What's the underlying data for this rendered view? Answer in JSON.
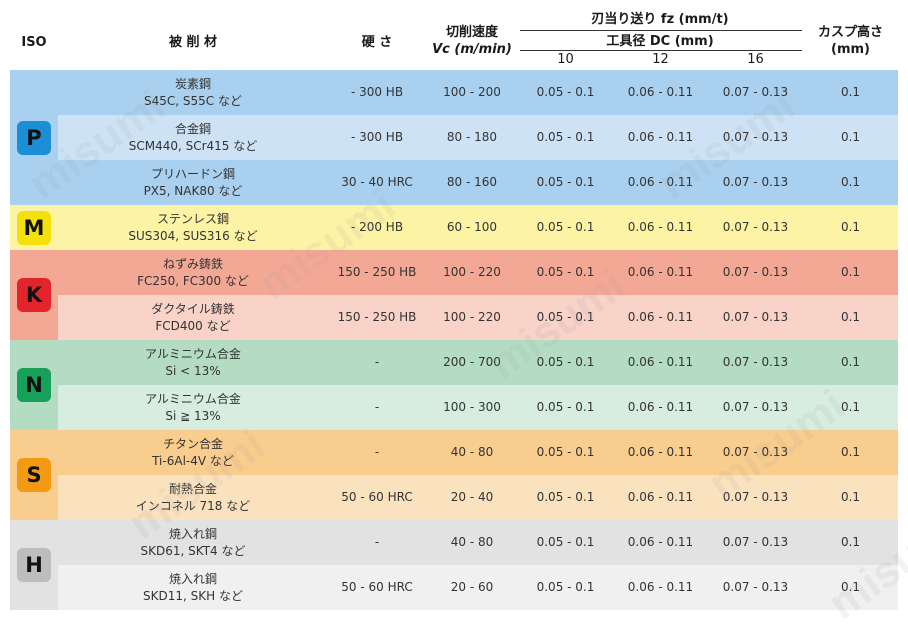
{
  "header": {
    "iso": "ISO",
    "material": "被 削 材",
    "hardness": "硬 さ",
    "speed_line1": "切削速度",
    "speed_line2": "Vc (m/min)",
    "feed_title": "刃当り送り fz (mm/t)",
    "diameter_title": "工具径 DC (mm)",
    "diameters": [
      "10",
      "12",
      "16"
    ],
    "cusp_line1": "カスプ高さ",
    "cusp_line2": "(mm)"
  },
  "watermark": "misumi",
  "groups": [
    {
      "code": "P",
      "color": "#1a8fd6",
      "rows": [
        0,
        1,
        2
      ]
    },
    {
      "code": "M",
      "color": "#f5e10a",
      "rows": [
        3
      ]
    },
    {
      "code": "K",
      "color": "#e3252b",
      "rows": [
        4,
        5
      ]
    },
    {
      "code": "N",
      "color": "#16a05a",
      "rows": [
        6,
        7
      ]
    },
    {
      "code": "S",
      "color": "#f39a12",
      "rows": [
        8,
        9
      ]
    },
    {
      "code": "H",
      "color": "#bdbdbd",
      "rows": [
        10,
        11
      ]
    }
  ],
  "rows": [
    {
      "material": "炭素鋼",
      "grades": "S45C, S55C など",
      "hardness": "- 300 HB",
      "speed": "100 - 200",
      "fz10": "0.05 - 0.1",
      "fz12": "0.06 - 0.11",
      "fz16": "0.07 - 0.13",
      "cusp": "0.1",
      "bg": "#a9d0ef"
    },
    {
      "material": "合金鋼",
      "grades": "SCM440, SCr415 など",
      "hardness": "- 300 HB",
      "speed": "80 - 180",
      "fz10": "0.05 - 0.1",
      "fz12": "0.06 - 0.11",
      "fz16": "0.07 - 0.13",
      "cusp": "0.1",
      "bg": "#cde3f5"
    },
    {
      "material": "プリハードン鋼",
      "grades": "PX5, NAK80 など",
      "hardness": "30 - 40 HRC",
      "speed": "80 - 160",
      "fz10": "0.05 - 0.1",
      "fz12": "0.06 - 0.11",
      "fz16": "0.07 - 0.13",
      "cusp": "0.1",
      "bg": "#a9d0ef"
    },
    {
      "material": "ステンレス鋼",
      "grades": "SUS304, SUS316 など",
      "hardness": "- 200 HB",
      "speed": "60 - 100",
      "fz10": "0.05 - 0.1",
      "fz12": "0.06 - 0.11",
      "fz16": "0.07 - 0.13",
      "cusp": "0.1",
      "bg": "#fcf3a4"
    },
    {
      "material": "ねずみ鋳鉄",
      "grades": "FC250, FC300 など",
      "hardness": "150 - 250 HB",
      "speed": "100 - 220",
      "fz10": "0.05 - 0.1",
      "fz12": "0.06 - 0.11",
      "fz16": "0.07 - 0.13",
      "cusp": "0.1",
      "bg": "#f3a896"
    },
    {
      "material": "ダクタイル鋳鉄",
      "grades": "FCD400 など",
      "hardness": "150 - 250 HB",
      "speed": "100 - 220",
      "fz10": "0.05 - 0.1",
      "fz12": "0.06 - 0.11",
      "fz16": "0.07 - 0.13",
      "cusp": "0.1",
      "bg": "#f9d2c8"
    },
    {
      "material": "アルミニウム合金",
      "grades": "Si < 13%",
      "hardness": "-",
      "speed": "200 - 700",
      "fz10": "0.05 - 0.1",
      "fz12": "0.06 - 0.11",
      "fz16": "0.07 - 0.13",
      "cusp": "0.1",
      "bg": "#b4dcc3"
    },
    {
      "material": "アルミニウム合金",
      "grades": "Si ≧ 13%",
      "hardness": "-",
      "speed": "100 - 300",
      "fz10": "0.05 - 0.1",
      "fz12": "0.06 - 0.11",
      "fz16": "0.07 - 0.13",
      "cusp": "0.1",
      "bg": "#d7ede0"
    },
    {
      "material": "チタン合金",
      "grades": "Ti-6Al-4V など",
      "hardness": "-",
      "speed": "40 - 80",
      "fz10": "0.05 - 0.1",
      "fz12": "0.06 - 0.11",
      "fz16": "0.07 - 0.13",
      "cusp": "0.1",
      "bg": "#f9cd8e"
    },
    {
      "material": "耐熱合金",
      "grades": "インコネル 718 など",
      "hardness": "50 - 60 HRC",
      "speed": "20 - 40",
      "fz10": "0.05 - 0.1",
      "fz12": "0.06 - 0.11",
      "fz16": "0.07 - 0.13",
      "cusp": "0.1",
      "bg": "#fbe2bf"
    },
    {
      "material": "焼入れ鋼",
      "grades": "SKD61, SKT4 など",
      "hardness": "-",
      "speed": "40 - 80",
      "fz10": "0.05 - 0.1",
      "fz12": "0.06 - 0.11",
      "fz16": "0.07 - 0.13",
      "cusp": "0.1",
      "bg": "#e2e2e2"
    },
    {
      "material": "焼入れ鋼",
      "grades": "SKD11, SKH など",
      "hardness": "50 - 60 HRC",
      "speed": "20 - 60",
      "fz10": "0.05 - 0.1",
      "fz12": "0.06 - 0.11",
      "fz16": "0.07 - 0.13",
      "cusp": "0.1",
      "bg": "#f0f0f0"
    }
  ]
}
